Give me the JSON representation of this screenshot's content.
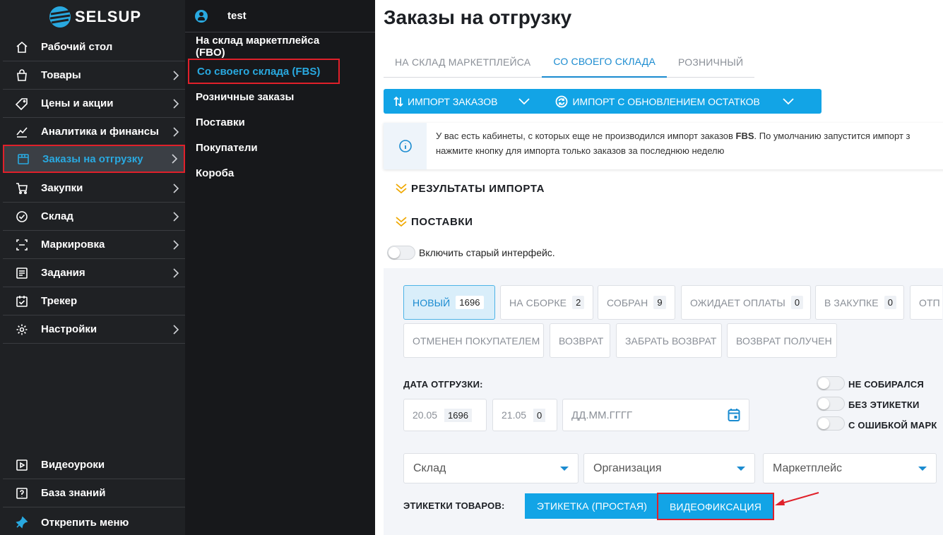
{
  "brand": {
    "name": "SELSUP"
  },
  "sidebar": {
    "items": [
      {
        "label": "Рабочий стол",
        "icon": "home-icon",
        "chevron": false
      },
      {
        "label": "Товары",
        "icon": "bag-icon",
        "chevron": true
      },
      {
        "label": "Цены и акции",
        "icon": "tag-icon",
        "chevron": true
      },
      {
        "label": "Аналитика и финансы",
        "icon": "chart-line-icon",
        "chevron": true
      },
      {
        "label": "Заказы на отгрузку",
        "icon": "box-icon",
        "chevron": true,
        "active": true
      },
      {
        "label": "Закупки",
        "icon": "cart-icon",
        "chevron": true
      },
      {
        "label": "Склад",
        "icon": "check-circle-icon",
        "chevron": true
      },
      {
        "label": "Маркировка",
        "icon": "scan-icon",
        "chevron": true
      },
      {
        "label": "Задания",
        "icon": "task-list-icon",
        "chevron": true
      },
      {
        "label": "Трекер",
        "icon": "calendar-check-icon",
        "chevron": false
      },
      {
        "label": "Настройки",
        "icon": "gear-icon",
        "chevron": true
      }
    ],
    "bottom": [
      {
        "label": "Видеоуроки",
        "icon": "video-icon"
      },
      {
        "label": "База знаний",
        "icon": "question-icon"
      },
      {
        "label": "Открепить меню",
        "icon": "pin-icon"
      }
    ]
  },
  "submenu": {
    "user": "test",
    "items": [
      {
        "label": "На склад маркетплейса (FBO)"
      },
      {
        "label": "Со своего склада (FBS)",
        "active": true
      },
      {
        "label": "Розничные заказы"
      },
      {
        "label": "Поставки"
      },
      {
        "label": "Покупатели"
      },
      {
        "label": "Короба"
      }
    ]
  },
  "main": {
    "title": "Заказы на отгрузку",
    "tabs": [
      {
        "label": "НА СКЛАД МАРКЕТПЛЕЙСА"
      },
      {
        "label": "СО СВОЕГО СКЛАДА",
        "active": true
      },
      {
        "label": "РОЗНИЧНЫЙ"
      }
    ],
    "import_orders": "ИМПОРТ ЗАКАЗОВ",
    "import_with_stock": "ИМПОРТ С ОБНОВЛЕНИЕМ ОСТАТКОВ",
    "info": {
      "line1_a": "У вас есть кабинеты, с которых еще не производился импорт заказов ",
      "line1_b": "FBS",
      "line1_c": ". По умолчанию запустится импорт з",
      "line2": "нажмите кнопку для импорта только заказов за последнюю неделю"
    },
    "section_import_results": "РЕЗУЛЬТАТЫ ИМПОРТА",
    "section_supplies": "ПОСТАВКИ",
    "old_interface": "Включить старый интерфейс.",
    "status_chips": [
      {
        "label": "НОВЫЙ",
        "count": "1696",
        "selected": true
      },
      {
        "label": "НА СБОРКЕ",
        "count": "2"
      },
      {
        "label": "СОБРАН",
        "count": "9"
      },
      {
        "label": "ОЖИДАЕТ ОПЛАТЫ",
        "count": "0"
      },
      {
        "label": "В ЗАКУПКЕ",
        "count": "0"
      },
      {
        "label": "ОТП",
        "count": ""
      },
      {
        "label": "ОТМЕНЕН ПОКУПАТЕЛЕМ",
        "count": ""
      },
      {
        "label": "ВОЗВРАТ",
        "count": ""
      },
      {
        "label": "ЗАБРАТЬ ВОЗВРАТ",
        "count": ""
      },
      {
        "label": "ВОЗВРАТ ПОЛУЧЕН",
        "count": ""
      }
    ],
    "ship_date_label": "ДАТА ОТГРУЗКИ:",
    "date1": {
      "date": "20.05",
      "count": "1696"
    },
    "date2": {
      "date": "21.05",
      "count": "0"
    },
    "date_placeholder": "ДД.ММ.ГГГГ",
    "toggles": [
      {
        "label": "НЕ СОБИРАЛСЯ"
      },
      {
        "label": "БЕЗ ЭТИКЕТКИ"
      },
      {
        "label": "С ОШИБКОЙ МАРК"
      }
    ],
    "filters": {
      "warehouse": "Склад",
      "organization": "Организация",
      "marketplace": "Маркетплейс"
    },
    "labels_title": "ЭТИКЕТКИ ТОВАРОВ:",
    "btn_simple_label": "ЭТИКЕТКА (ПРОСТАЯ)",
    "btn_video": "ВИДЕОФИКСАЦИЯ"
  },
  "colors": {
    "accent": "#12a4e6",
    "highlight": "#e0202a",
    "sidebar": "#1f2124",
    "warning": "#f0a800"
  }
}
